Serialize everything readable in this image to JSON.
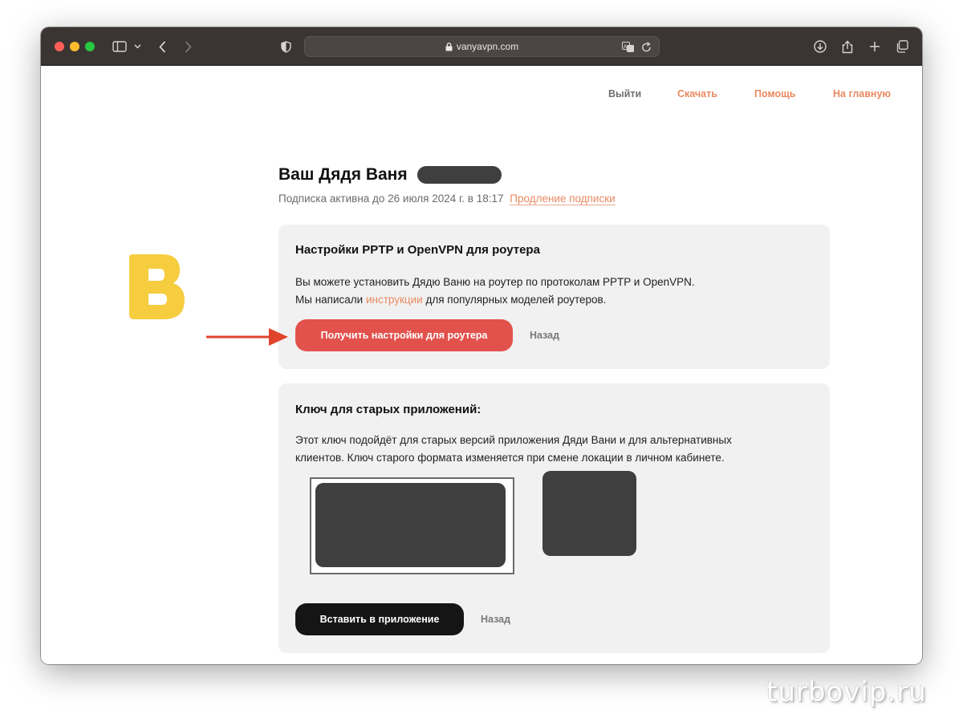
{
  "browser": {
    "url": "vanyavpn.com"
  },
  "nav": {
    "logout": "Выйти",
    "download": "Скачать",
    "help": "Помощь",
    "home": "На главную"
  },
  "brand": {
    "logo_letter": "В",
    "logo_color": "#f5cd3f"
  },
  "account": {
    "title": "Ваш Дядя Ваня",
    "subscription_text": "Подписка активна до 26 июля 2024 г. в 18:17",
    "renew_link": "Продление подписки"
  },
  "router_card": {
    "heading": "Настройки PPTP и OpenVPN для роутера",
    "line1": "Вы можете установить Дядю Ваню на роутер по протоколам PPTP и OpenVPN.",
    "line2_before": "Мы написали ",
    "line2_link": "инструкции",
    "line2_after": " для популярных моделей роутеров.",
    "primary_button": "Получить настройки для роутера",
    "back_link": "Назад"
  },
  "legacy_key_card": {
    "heading": "Ключ для старых приложений:",
    "line1": "Этот ключ подойдёт для старых версий приложения Дяди Вани и для альтернативных",
    "line2": "клиентов. Ключ старого формата изменяется при смене локации в личном кабинете.",
    "primary_button": "Вставить в приложение",
    "back_link": "Назад"
  },
  "annotation": {
    "arrow_color": "#e0452b"
  },
  "watermark": "turbovip.ru",
  "colors": {
    "accent": "#e98a62",
    "primary_button": "#e2514c",
    "dark_button": "#151515",
    "card_bg": "#f1f1f1",
    "redaction": "#3f3f3f"
  }
}
